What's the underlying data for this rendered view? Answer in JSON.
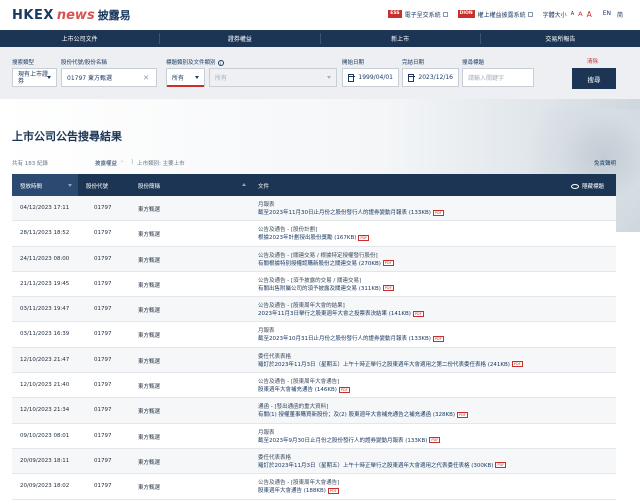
{
  "header": {
    "logo_brand": "HKEX",
    "logo_news": "news",
    "logo_zh": "披露易",
    "ess_badge": "ESS",
    "ess_label": "電子呈交系統",
    "dion_badge": "DION",
    "dion_label": "權上權益披露系統",
    "font_size_label": "字體大小",
    "font_a": "A",
    "lang_en": "EN",
    "lang_sc": "简"
  },
  "nav": {
    "items": [
      "上市公司文件",
      "證券權益",
      "新上市",
      "交易所報告"
    ]
  },
  "search": {
    "category_label": "搜索類型",
    "category_value": "現有上市證券",
    "stock_label": "股份代號/股份名稱",
    "stock_value": "01797 東方甄選",
    "doctype_label": "標題類別及文件類別",
    "doctype_value": "所有",
    "doctype_sub_placeholder": "所有",
    "from_label": "開始日期",
    "from_value": "1999/04/01",
    "to_label": "完結日期",
    "to_value": "2023/12/16",
    "headline_label": "搜尋標題",
    "headline_placeholder": "請輸入關鍵字",
    "clear_label": "清除",
    "search_button": "搜尋"
  },
  "results": {
    "title": "上市公司公告搜尋結果",
    "summary": "共有 183 紀錄",
    "crumb_1": "披露權益",
    "crumb_2": "上市類別: 主要上市",
    "disclaimer": "免責聲明"
  },
  "table": {
    "headers": {
      "date": "發放時間",
      "code": "股份代號",
      "name": "股份簡稱",
      "docs": "文件",
      "hide": "隱藏標題"
    },
    "rows": [
      {
        "date": "04/12/2023 17:11",
        "code": "01797",
        "name": "東方甄選",
        "type": "月報表",
        "link": "截至2023年11月30日止月份之股份發行人的證券變動月報表 (133KB)"
      },
      {
        "date": "28/11/2023 18:52",
        "code": "01797",
        "name": "東方甄選",
        "type": "公告及通告 - [股份計劃]",
        "link": "根據2023年計劃授出股份獎勵 (167KB)"
      },
      {
        "date": "24/11/2023 08:00",
        "code": "01797",
        "name": "東方甄選",
        "type": "公告及通告 - [關連交易 / 根據特定授權發行股份]",
        "link": "有關根據特別授權認購新股份之關連交易 (270KB)"
      },
      {
        "date": "21/11/2023 19:45",
        "code": "01797",
        "name": "東方甄選",
        "type": "公告及通告 - [須予披露的交易 / 關連交易]",
        "link": "有關出售附屬公司的須予披露及關連交易 (311KB)"
      },
      {
        "date": "03/11/2023 19:47",
        "code": "01797",
        "name": "東方甄選",
        "type": "公告及通告 - [股東周年大會的結果]",
        "link": "2023年11月3日舉行之股東週年大會之投票表決結果 (141KB)"
      },
      {
        "date": "03/11/2023 16:39",
        "code": "01797",
        "name": "東方甄選",
        "type": "月報表",
        "link": "截至2023年10月31日止月份之股份發行人的證券變動月報表 (133KB)"
      },
      {
        "date": "12/10/2023 21:47",
        "code": "01797",
        "name": "東方甄選",
        "type": "委任代表表格",
        "link": "羅訂於2023年11月3日（星期五）上午十時正舉行之股東週年大會適用之第二份代表委任表格 (241KB)"
      },
      {
        "date": "12/10/2023 21:40",
        "code": "01797",
        "name": "東方甄選",
        "type": "公告及通告 - [股東周年大會通告]",
        "link": "股東週年大會補充通告 (146KB)"
      },
      {
        "date": "12/10/2023 21:34",
        "code": "01797",
        "name": "東方甄選",
        "type": "通函 - [發出通函的重大資料]",
        "link": "有關(1) 授權董事購買新股份；及(2) 股東週年大會補充通告之補充通函 (328KB)"
      },
      {
        "date": "09/10/2023 08:01",
        "code": "01797",
        "name": "東方甄選",
        "type": "月報表",
        "link": "截至2023年9月30日止月份之股份發行人的證券變動月報表 (133KB)"
      },
      {
        "date": "20/09/2023 18:11",
        "code": "01797",
        "name": "東方甄選",
        "type": "委任代表表格",
        "link": "羅訂於2023年11月3日（星期五）上午十時正舉行之股東週年大會適用之代表委任表格 (300KB)"
      },
      {
        "date": "20/09/2023 18:02",
        "code": "01797",
        "name": "東方甄選",
        "type": "公告及通告 - [股東周年大會通告]",
        "link": "股東週年大會通告 (188KB)"
      }
    ]
  },
  "pdf_tag": "PDF",
  "colors": {
    "navy": "#1c3555",
    "accent_red": "#c9302c"
  }
}
